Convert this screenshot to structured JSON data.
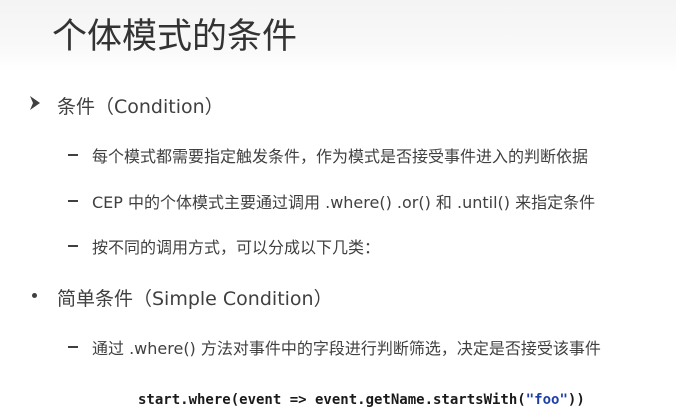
{
  "slide": {
    "title": "个体模式的条件",
    "bullets": [
      {
        "label": "条件（Condition）",
        "subitems": [
          "每个模式都需要指定触发条件，作为模式是否接受事件进入的判断依据",
          "CEP 中的个体模式主要通过调用 .where()  .or() 和 .until() 来指定条件",
          "按不同的调用方式，可以分成以下几类："
        ]
      },
      {
        "label": "简单条件（Simple Condition）",
        "subitems": [
          "通过 .where() 方法对事件中的字段进行判断筛选，决定是否接受该事件"
        ]
      }
    ],
    "code": {
      "prefix": "start.where(event => event.getName.startsWith(",
      "string_literal": "\"foo\"",
      "suffix": "))"
    },
    "icons": {
      "first_bullet": "arrow-bullet-icon",
      "second_bullet": "dot-bullet-icon",
      "sub_bullet": "dash-bullet-icon"
    },
    "colors": {
      "text": "#404040",
      "title": "#333333",
      "code_string": "#1f3fa8"
    }
  }
}
